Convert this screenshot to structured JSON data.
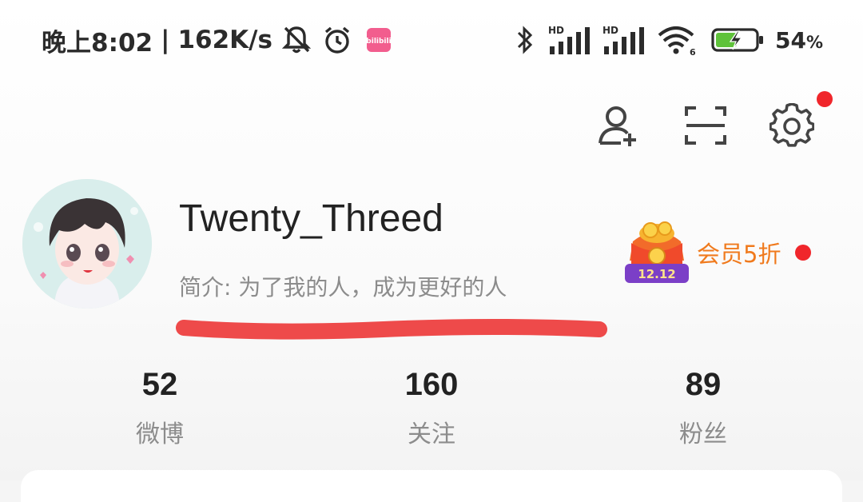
{
  "status_bar": {
    "time": "晚上8:02",
    "network_speed": "162K/s",
    "battery_percent": "54",
    "battery_unit": "%",
    "hd_label": "HD",
    "wifi_sub": "6",
    "app_icon": "bilibili",
    "icons": [
      "mute-bell-icon",
      "alarm-icon",
      "bilibili-icon",
      "bluetooth-icon",
      "signal-hd-icon",
      "signal-hd-icon",
      "wifi-icon",
      "battery-charging-icon"
    ]
  },
  "top_actions": {
    "icons": [
      "add-friend-icon",
      "scan-icon",
      "settings-icon"
    ],
    "settings_has_badge": true
  },
  "profile": {
    "username": "Twenty_Threed",
    "bio": "简介: 为了我的人，成为更好的人"
  },
  "vip": {
    "badge_text": "12.12",
    "label": "会员5折"
  },
  "stats": [
    {
      "value": "52",
      "label": "微博"
    },
    {
      "value": "160",
      "label": "关注"
    },
    {
      "value": "89",
      "label": "粉丝"
    }
  ],
  "colors": {
    "accent_red": "#f0262b",
    "vip_orange": "#f07a1d",
    "underline_red": "#ee4a4a",
    "text_dark": "#222222",
    "text_gray": "#8c8c8c"
  }
}
